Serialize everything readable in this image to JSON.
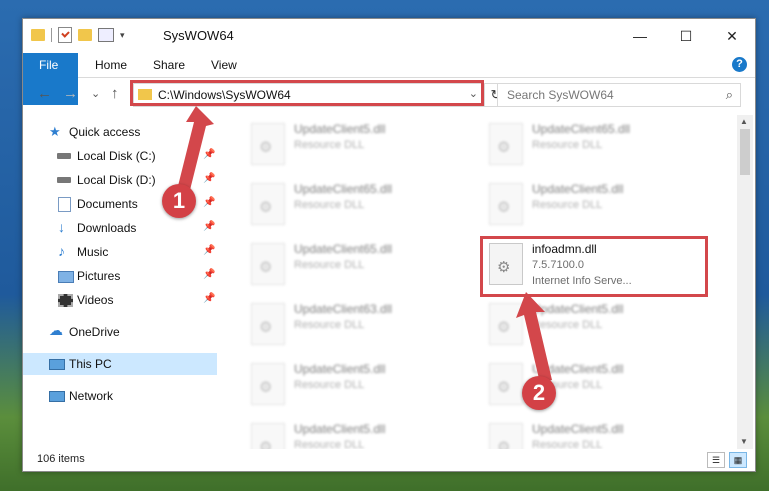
{
  "window": {
    "title": "SysWOW64",
    "minimize": "—",
    "maximize": "☐",
    "close": "✕"
  },
  "ribbon": {
    "tabs": [
      "File",
      "Home",
      "Share",
      "View"
    ],
    "help": "?"
  },
  "address": {
    "path": "C:\\Windows\\SysWOW64",
    "dropdown": "⌄",
    "refresh": "↻"
  },
  "search": {
    "placeholder": "Search SysWOW64",
    "icon": "⌕"
  },
  "nav": {
    "back": "←",
    "forward": "→",
    "recent": "⌄",
    "up": "↑"
  },
  "sidebar": {
    "items": [
      {
        "label": "Quick access",
        "icon": "star-icon"
      },
      {
        "label": "Local Disk (C:)",
        "icon": "drive-icon",
        "pinned": true
      },
      {
        "label": "Local Disk (D:)",
        "icon": "drive-icon",
        "pinned": true
      },
      {
        "label": "Documents",
        "icon": "documents-icon",
        "pinned": true
      },
      {
        "label": "Downloads",
        "icon": "download-icon",
        "pinned": true
      },
      {
        "label": "Music",
        "icon": "music-icon",
        "pinned": true
      },
      {
        "label": "Pictures",
        "icon": "pictures-icon",
        "pinned": true
      },
      {
        "label": "Videos",
        "icon": "videos-icon",
        "pinned": true
      },
      {
        "label": "OneDrive",
        "icon": "cloud-icon"
      },
      {
        "label": "This PC",
        "icon": "pc-icon",
        "selected": true
      },
      {
        "label": "Network",
        "icon": "network-icon"
      }
    ],
    "pin_glyph": "📌"
  },
  "files": [
    {
      "name": "UpdateClient5.dll",
      "type": "Resource DLL"
    },
    {
      "name": "UpdateClient65.dll",
      "type": "Resource DLL"
    },
    {
      "name": "UpdateClient65.dll",
      "type": "Resource DLL"
    },
    {
      "name": "UpdateClient5.dll",
      "type": "Resource DLL"
    },
    {
      "name": "UpdateClient65.dll",
      "type": "Resource DLL"
    },
    {
      "name": "infoadmn.dll",
      "type": "7.5.7100.0",
      "desc": "Internet Info Serve..."
    },
    {
      "name": "UpdateClient63.dll",
      "type": "Resource DLL"
    },
    {
      "name": "UpdateClient5.dll",
      "type": "Resource DLL"
    },
    {
      "name": "UpdateClient5.dll",
      "type": "Resource DLL"
    },
    {
      "name": "UpdateClient5.dll",
      "type": "Resource DLL"
    },
    {
      "name": "UpdateClient5.dll",
      "type": "Resource DLL"
    },
    {
      "name": "UpdateClient5.dll",
      "type": "Resource DLL"
    }
  ],
  "status": {
    "count": "106 items"
  },
  "annotations": {
    "badge1": "1",
    "badge2": "2",
    "color": "#d3474b"
  },
  "colors": {
    "accent": "#1979ca",
    "selected": "#cce8ff",
    "highlight": "#d3474b"
  }
}
